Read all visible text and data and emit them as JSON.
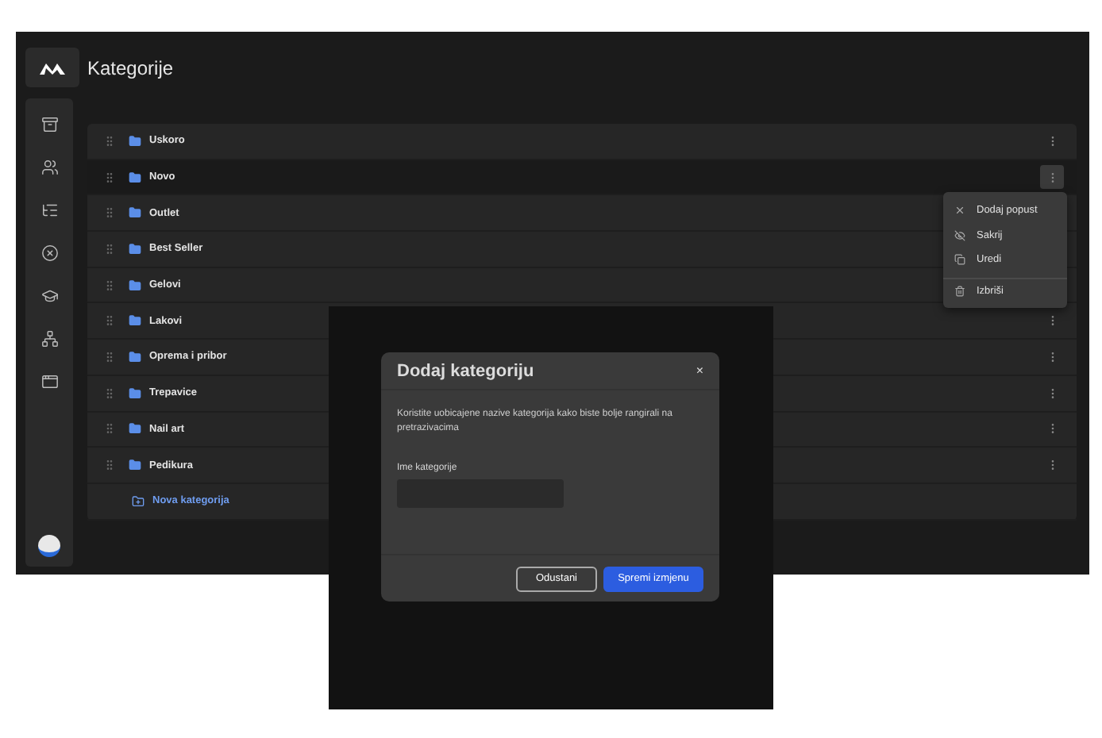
{
  "header": {
    "title": "Kategorije"
  },
  "sidebar": {
    "items": [
      {
        "selected": false
      },
      {
        "selected": false
      },
      {
        "selected": false
      },
      {
        "selected": false
      },
      {
        "selected": false
      },
      {
        "selected": false
      },
      {
        "selected": false
      }
    ]
  },
  "categories": [
    {
      "name": "Uskoro",
      "selected": false
    },
    {
      "name": "Novo",
      "selected": true
    },
    {
      "name": "Outlet",
      "selected": false
    },
    {
      "name": "Best Seller",
      "selected": false
    },
    {
      "name": "Gelovi",
      "selected": false
    },
    {
      "name": "Lakovi",
      "selected": false
    },
    {
      "name": "Oprema i pribor",
      "selected": false
    },
    {
      "name": "Trepavice",
      "selected": false
    },
    {
      "name": "Nail art",
      "selected": false
    },
    {
      "name": "Pedikura",
      "selected": false
    }
  ],
  "add_category": "Nova kategorija",
  "context_menu": {
    "items": [
      {
        "label": "Dodaj popust",
        "danger": false
      },
      {
        "label": "Sakrij",
        "danger": false
      },
      {
        "label": "Uredi",
        "danger": false
      },
      {
        "label": "Izbriši",
        "danger": true
      }
    ]
  },
  "dialog": {
    "title": "Dodaj kategoriju",
    "close": "×",
    "description": "Koristite uobicajene nazive kategorija kako biste bolje rangirali na pretrazivacima",
    "field_label": "Ime kategorije",
    "cancel": "Odustani",
    "save": "Spremi izmjenu"
  }
}
